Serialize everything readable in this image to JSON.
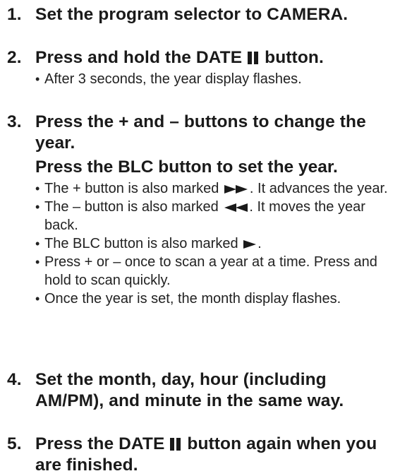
{
  "steps": [
    {
      "number": "1.",
      "title": "Set the program selector to CAMERA."
    },
    {
      "number": "2.",
      "title_before": "Press and hold the DATE",
      "title_after": "button.",
      "bullets": [
        "After 3 seconds, the year display flashes."
      ]
    },
    {
      "number": "3.",
      "title": "Press the + and – buttons to change the year.",
      "subtitle": "Press the BLC button to set the year.",
      "bullets": [
        {
          "before": "The + button is also marked",
          "icon": "fast-forward-icon",
          "after": ". It advances the year."
        },
        {
          "before": "The – button is also marked",
          "icon": "rewind-icon",
          "after": ". It moves the year back."
        },
        {
          "before": "The BLC button is also marked",
          "icon": "play-icon",
          "after": "."
        },
        {
          "text": "Press + or – once to scan a year at a time. Press and hold to scan quickly."
        },
        {
          "text": "Once the year is set, the month display flashes."
        }
      ]
    },
    {
      "number": "4.",
      "title": "Set the month, day, hour (including AM/PM), and minute in the same way."
    },
    {
      "number": "5.",
      "title_before": "Press the DATE",
      "title_after": "button again when you are finished."
    }
  ],
  "bullet_glyph": "•",
  "icons": {
    "pause": "pause-icon",
    "fast_forward": "fast-forward-icon",
    "rewind": "rewind-icon",
    "play": "play-icon"
  }
}
